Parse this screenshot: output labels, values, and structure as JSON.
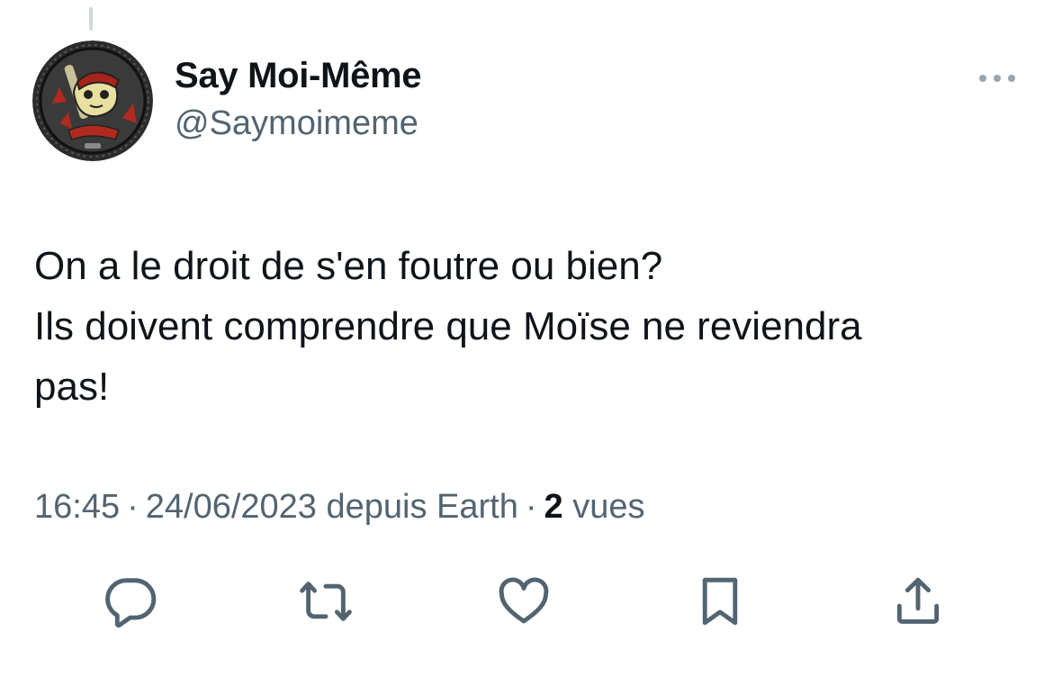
{
  "tweet": {
    "author": {
      "display_name": "Say Moi-Même",
      "handle": "@Saymoimeme",
      "avatar_icon": "baseball-mascot-avatar"
    },
    "text_lines": [
      "On a le droit de s'en foutre ou bien?",
      "Ils doivent comprendre que Moïse ne reviendra",
      "pas!"
    ],
    "meta": {
      "time": "16:45",
      "separator": "·",
      "date_source": "24/06/2023 depuis Earth",
      "views_count": "2",
      "views_label": "vues"
    },
    "actions": [
      {
        "name": "reply",
        "icon": "reply-icon"
      },
      {
        "name": "retweet",
        "icon": "retweet-icon"
      },
      {
        "name": "like",
        "icon": "heart-icon"
      },
      {
        "name": "bookmark",
        "icon": "bookmark-icon"
      },
      {
        "name": "share",
        "icon": "share-icon"
      }
    ],
    "more_icon": "more-dots-icon"
  },
  "colors": {
    "text_primary": "#0f1419",
    "text_secondary": "#536471",
    "icon": "#536471",
    "thread_line": "#cfd9de"
  }
}
